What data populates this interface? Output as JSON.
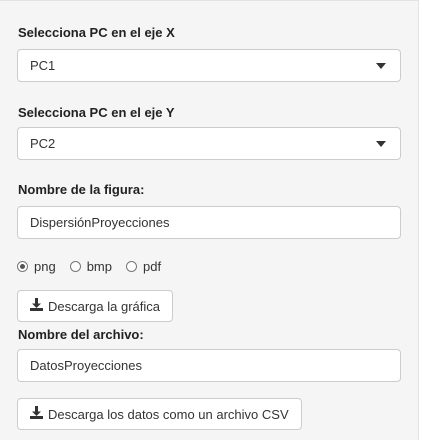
{
  "x_axis": {
    "label": "Selecciona PC en el eje X",
    "selected": "PC1"
  },
  "y_axis": {
    "label": "Selecciona PC en el eje Y",
    "selected": "PC2"
  },
  "figure": {
    "label": "Nombre de la figura:",
    "value": "DispersiónProyecciones"
  },
  "format": {
    "options": [
      "png",
      "bmp",
      "pdf"
    ],
    "selected": "png"
  },
  "download_plot": {
    "label": "Descarga la gráfica",
    "icon": "download-icon"
  },
  "file": {
    "label": "Nombre del archivo:",
    "value": "DatosProyecciones"
  },
  "download_data": {
    "label": "Descarga los datos como un archivo CSV",
    "icon": "download-icon"
  }
}
